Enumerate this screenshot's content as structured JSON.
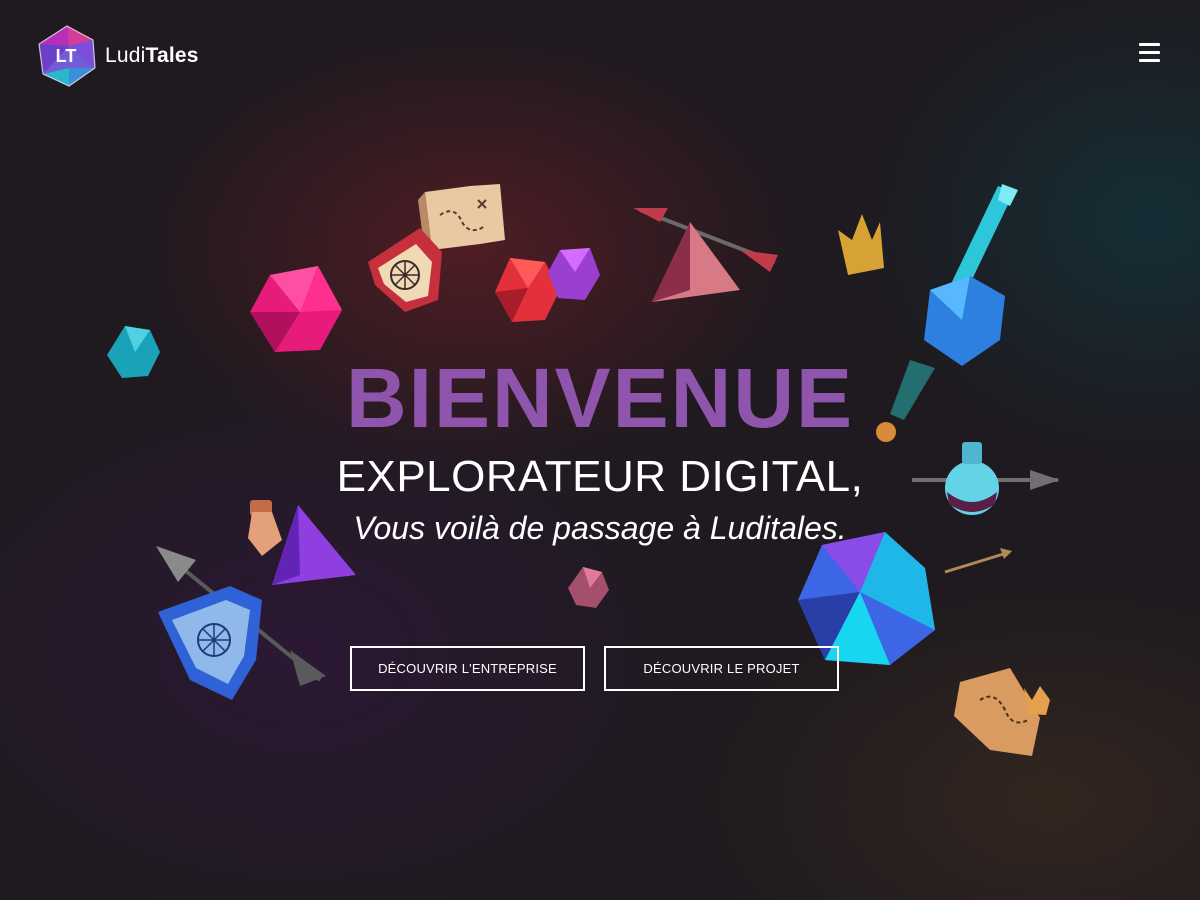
{
  "brand": {
    "name_part1": "Ludi",
    "name_part2": "Tales",
    "monogram": "LT"
  },
  "header": {
    "menu_icon": "hamburger-menu-icon"
  },
  "hero": {
    "title": "BIENVENUE",
    "subtitle": "EXPLORATEUR DIGITAL,",
    "tagline": "Vous voilà de passage à Luditales.",
    "buttons": {
      "company": "DÉCOUVRIR L'ENTREPRISE",
      "project": "DÉCOUVRIR LE PROJET"
    }
  },
  "colors": {
    "accent_purple": "#8f55ad",
    "background": "#1e1a1f",
    "text": "#ffffff"
  }
}
